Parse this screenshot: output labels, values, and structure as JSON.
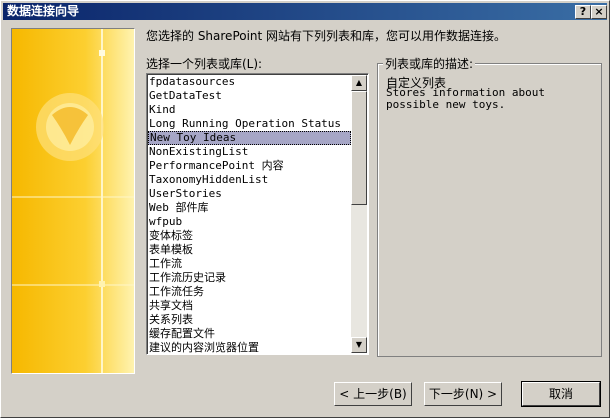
{
  "window": {
    "title": "数据连接向导"
  },
  "titlebar_buttons": {
    "help": "?",
    "close": "×"
  },
  "intro_text": "您选择的 SharePoint 网站有下列列表和库，您可以用作数据连接。",
  "list_label": "选择一个列表或库(L):",
  "lists": [
    "fpdatasources",
    "GetDataTest",
    "Kind",
    "Long Running Operation Status",
    "New Toy Ideas",
    "NonExistingList",
    "PerformancePoint 内容",
    "TaxonomyHiddenList",
    "UserStories",
    "Web 部件库",
    "wfpub",
    "变体标签",
    "表单模板",
    "工作流",
    "工作流历史记录",
    "工作流任务",
    "共享文档",
    "关系列表",
    "缓存配置文件",
    "建议的内容浏览器位置"
  ],
  "selected_index": 4,
  "description": {
    "group_label": "列表或库的描述:",
    "title": "自定义列表",
    "text": "Stores information about possible new toys."
  },
  "buttons": {
    "back": "< 上一步(B)",
    "next": "下一步(N) >",
    "cancel": "取消"
  }
}
